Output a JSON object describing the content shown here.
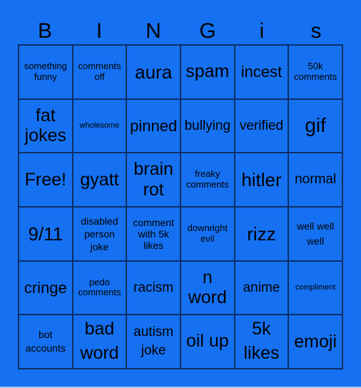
{
  "title_letters": [
    "B",
    "I",
    "N",
    "G",
    "i",
    "s"
  ],
  "colors": {
    "background": "#1571f2",
    "grid_line": "#0c2f63",
    "text": "#000000"
  },
  "cells": [
    [
      "something funny",
      "comments off",
      "aura",
      "spam",
      "incest",
      "50k comments"
    ],
    [
      "fat jokes",
      "wholesome",
      "pinned",
      "bullying",
      "verified",
      "gif"
    ],
    [
      "Free!",
      "gyatt",
      "brain rot",
      "freaky comments",
      "hitler",
      "normal"
    ],
    [
      "9/11",
      "disabled person joke",
      "comment with 5k likes",
      "downright evil",
      "rizz",
      "well well well"
    ],
    [
      "cringe",
      "pedo comments",
      "racism",
      "n word",
      "anime",
      "compliment"
    ],
    [
      "bot accounts",
      "bad word",
      "autism joke",
      "oil up",
      "5k likes",
      "emoji"
    ]
  ]
}
